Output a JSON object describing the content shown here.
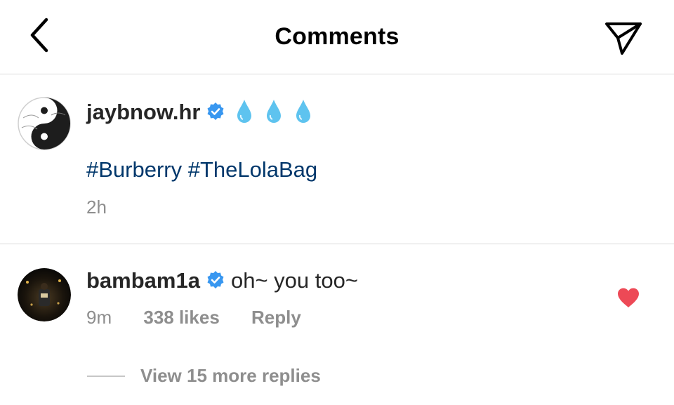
{
  "header": {
    "title": "Comments",
    "back_icon": "chevron-left-icon",
    "share_icon": "paper-plane-icon"
  },
  "caption": {
    "username": "jaybnow.hr",
    "verified_icon": "verified-badge-icon",
    "emoji": [
      "💧",
      "💧",
      "💧"
    ],
    "hashtags": [
      "#Burberry",
      "#TheLolaBag"
    ],
    "time": "2h"
  },
  "comment": {
    "username": "bambam1a",
    "verified_icon": "verified-badge-icon",
    "text": "oh~ you too~",
    "time": "9m",
    "likes": "338 likes",
    "reply_label": "Reply",
    "heart_icon": "heart-filled-icon",
    "view_replies": "View 15 more replies"
  },
  "colors": {
    "verified": "#3897f0",
    "hashtag": "#00376b",
    "heart": "#ed4956",
    "meta_text": "#8e8e8e",
    "divider": "#dbdbdb"
  }
}
